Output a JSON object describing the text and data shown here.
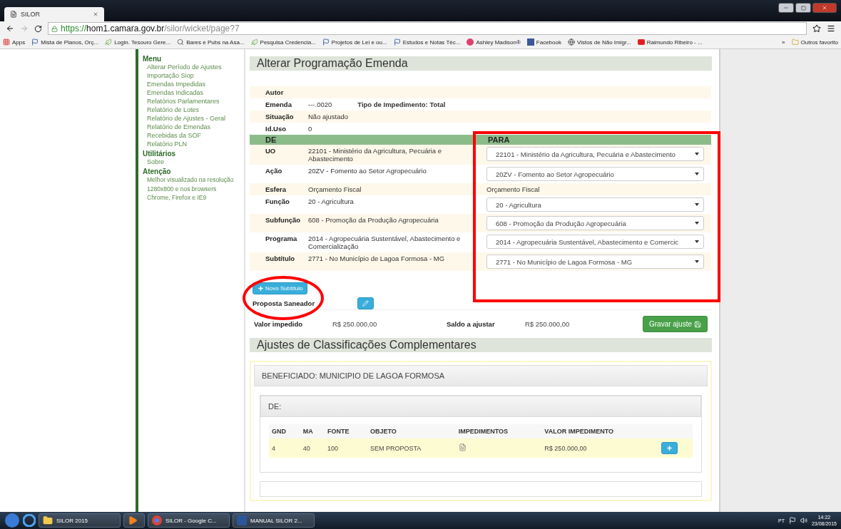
{
  "browser": {
    "tab_title": "SILOR",
    "url_host": "https://hom1.camara.gov.br",
    "url_path": "/silor/wicket/page?7",
    "bookmarks": [
      {
        "label": "Apps",
        "kind": "apps"
      },
      {
        "label": "Mista de Planos, Orç...",
        "kind": "flag"
      },
      {
        "label": "Login. Tesouro Gere...",
        "kind": "leaf"
      },
      {
        "label": "Bares e Pubs na Asa...",
        "kind": "search"
      },
      {
        "label": "Pesquisa Credencia...",
        "kind": "leaf"
      },
      {
        "label": "Projetos de Lei e ou...",
        "kind": "flag"
      },
      {
        "label": "Estudos e Notas Téc...",
        "kind": "flag"
      },
      {
        "label": "Ashley Madison®",
        "kind": "circle"
      },
      {
        "label": "Facebook",
        "kind": "facebook"
      },
      {
        "label": "Vistos de Não Imigr...",
        "kind": "globe"
      },
      {
        "label": "Raimundo Ribeiro - ...",
        "kind": "video"
      }
    ],
    "more": "»",
    "other_bookmarks": "Outros favorito"
  },
  "sidebar": [
    {
      "title": "Menu",
      "items": [
        {
          "label": "Alterar Período de Ajustes",
          "kind": "link"
        },
        {
          "label": "Importação Siop",
          "kind": "link"
        },
        {
          "label": "Emendas Impedidas",
          "kind": "link"
        },
        {
          "label": "Emendas Indicadas",
          "kind": "link"
        },
        {
          "label": "Relatórios Parlamentares",
          "kind": "link"
        },
        {
          "label": "Relatório de Lotes",
          "kind": "link"
        },
        {
          "label": "Relatório de Ajustes - Geral",
          "kind": "link"
        },
        {
          "label": "Relatório de Emendas Recebidas da SOF",
          "kind": "link"
        },
        {
          "label": "Relatório PLN",
          "kind": "link"
        }
      ]
    },
    {
      "title": "Utilitários",
      "items": [
        {
          "label": "Sobre",
          "kind": "link"
        }
      ]
    },
    {
      "title": "Atenção",
      "items": [
        {
          "label": "Melhor visualizado na resolução 1280x800 e nos browsers Chrome, Firefox e IE9",
          "kind": "note"
        }
      ]
    }
  ],
  "page_title": "Alterar Programação Emenda",
  "info": [
    {
      "label": "Autor"
    },
    {
      "label": "Emenda",
      "value": "---.0020",
      "extra": "Tipo de Impedimento: Total"
    },
    {
      "label": "Situação",
      "value": "Não ajustado"
    },
    {
      "label": "Id.Uso",
      "value": "0"
    }
  ],
  "de_header": "DE",
  "para_header": "PARA",
  "rows": [
    {
      "label": "UO",
      "de": "22101 - Ministério da Agricultura, Pecuária e Abastecimento",
      "para": "22101 - Ministério da Agricultura, Pecuária e Abastecimento",
      "kind": "select"
    },
    {
      "label": "Ação",
      "de": "20ZV - Fomento ao Setor Agropecuário",
      "para": "20ZV - Fomento ao Setor Agropecuário",
      "kind": "select"
    },
    {
      "label": "Esfera",
      "de": "Orçamento Fiscal",
      "para": "Orçamento Fiscal",
      "kind": "text"
    },
    {
      "label": "Função",
      "de": "20 - Agricultura",
      "para": "20 - Agricultura",
      "kind": "select"
    },
    {
      "label": "Subfunção",
      "de": "608 - Promoção da Produção Agropecuária",
      "para": "608 - Promoção da Produção Agropecuária",
      "kind": "select"
    },
    {
      "label": "Programa",
      "de": "2014 - Agropecuária Sustentável, Abastecimento e Comercialização",
      "para": "2014 - Agropecuária Sustentável, Abastecimento e Comercic",
      "kind": "select"
    },
    {
      "label": "Subtítulo",
      "de": "2771 - No Município de Lagoa Formosa - MG",
      "para": "2771 - No Município de Lagoa Formosa - MG",
      "kind": "select"
    }
  ],
  "new_subtitle_button": "Novo Subtítulo",
  "proposal_label": "Proposta Saneador",
  "totals": [
    {
      "label": "Valor impedido",
      "value": "R$ 250.000,00"
    },
    {
      "label": "Saldo a ajustar",
      "value": "R$ 250.000,00"
    }
  ],
  "save_button": "Gravar ajuste",
  "section_title": "Ajustes de Classificações Complementares",
  "beneficiary": "BENEFICIADO: MUNICIPIO DE LAGOA FORMOSA",
  "de_panel": {
    "title": "DE:",
    "columns": [
      "GND",
      "MA",
      "FONTE",
      "OBJETO",
      "IMPEDIMENTOS",
      "VALOR IMPEDIMENTO"
    ],
    "rows": [
      {
        "gnd": "4",
        "ma": "40",
        "fonte": "100",
        "objeto": "SEM PROPOSTA",
        "valor": "R$ 250.000,00"
      }
    ]
  },
  "taskbar": {
    "items": [
      {
        "label": "SILOR 2015",
        "kind": "folder"
      },
      {
        "kind": "media"
      },
      {
        "label": "SILOR - Google C...",
        "kind": "chrome"
      },
      {
        "label": "MANUAL SILOR 2...",
        "kind": "word"
      }
    ],
    "language": "PT",
    "time": "14:22",
    "date": "23/08/2015"
  }
}
